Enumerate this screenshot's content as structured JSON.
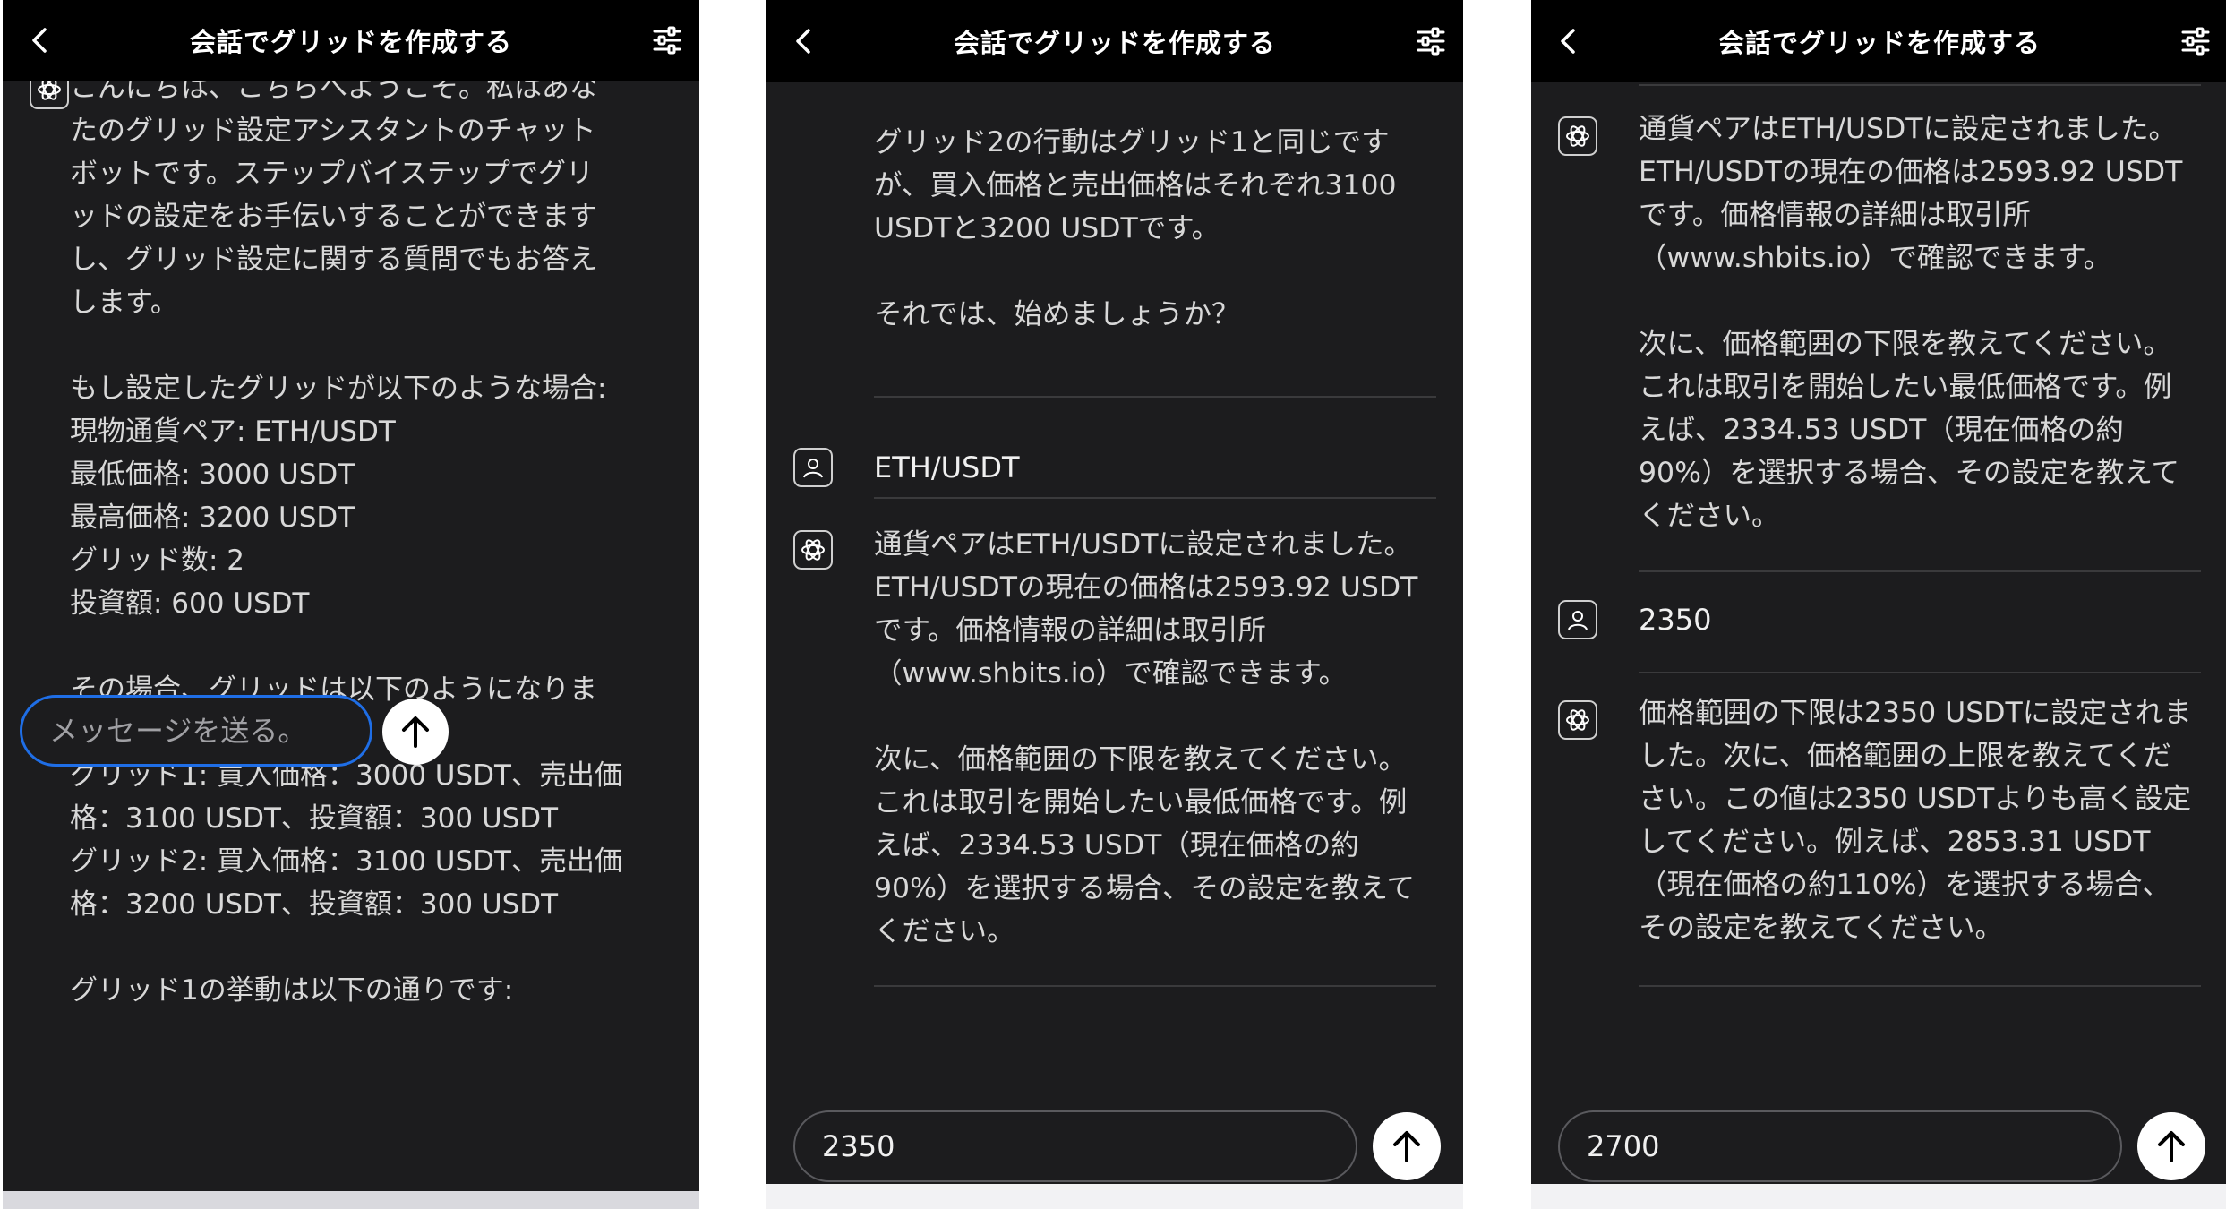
{
  "header": {
    "title": "会話でグリッドを作成する"
  },
  "panel1": {
    "bot_message": "こんにちは、こちらへようこそ。私はあな\nたのグリッド設定アシスタントのチャット\nボットです。ステップバイステップでグリ\nッドの設定をお手伝いすることができます\nし、グリッド設定に関する質問でもお答え\nします。\n\nもし設定したグリッドが以下のような場合:\n現物通貨ペア: ETH/USDT\n最低価格: 3000 USDT\n最高価格: 3200 USDT\nグリッド数: 2\n投資額: 600 USDT\n\nその場合、グリッドは以下のようになりま\nす:\nグリッド1: 買入価格：3000 USDT、売出価\n格：3100 USDT、投資額：300 USDT\nグリッド2: 買入価格：3100 USDT、売出価\n格：3200 USDT、投資額：300 USDT\n\nグリッド1の挙動は以下の通りです:",
    "input": {
      "value": "",
      "placeholder": "メッセージを送る。"
    }
  },
  "panel2": {
    "bot_message_tail": "価格で取引を行い、これを繰り返します。\n\nグリッド2の行動はグリッド1と同じです\nが、買入価格と売出価格はそれぞれ3100\nUSDTと3200 USDTです。\n\nそれでは、始めましょうか？",
    "user_message": "ETH/USDT",
    "bot_message": "通貨ペアはETH/USDTに設定されました。\nETH/USDTの現在の価格は2593.92 USDT\nです。価格情報の詳細は取引所\n（www.shbits.io）で確認できます。\n\n次に、価格範囲の下限を教えてください。\nこれは取引を開始したい最低価格です。例\nえば、2334.53 USDT（現在価格の約\n90%）を選択する場合、その設定を教えて\nください。",
    "input": {
      "value": "2350",
      "placeholder": ""
    }
  },
  "panel3": {
    "bot_message_1": "通貨ペアはETH/USDTに設定されました。\nETH/USDTの現在の価格は2593.92 USDT\nです。価格情報の詳細は取引所\n（www.shbits.io）で確認できます。\n\n次に、価格範囲の下限を教えてください。\nこれは取引を開始したい最低価格です。例\nえば、2334.53 USDT（現在価格の約\n90%）を選択する場合、その設定を教えて\nください。",
    "user_message": "2350",
    "bot_message_2": "価格範囲の下限は2350 USDTに設定されま\nした。次に、価格範囲の上限を教えてくだ\nさい。この値は2350 USDTよりも高く設定\nしてください。例えば、2853.31 USDT\n（現在価格の約110%）を選択する場合、\nその設定を教えてください。",
    "input": {
      "value": "2700",
      "placeholder": ""
    }
  },
  "colors": {
    "background": "#1c1c1e",
    "header": "#000000",
    "focus_border": "#1f6ee6",
    "divider": "#3a3a3c"
  },
  "icons": [
    "back-chevron-icon",
    "settings-sliders-icon",
    "bot-logo-icon",
    "user-icon",
    "send-arrow-icon"
  ]
}
